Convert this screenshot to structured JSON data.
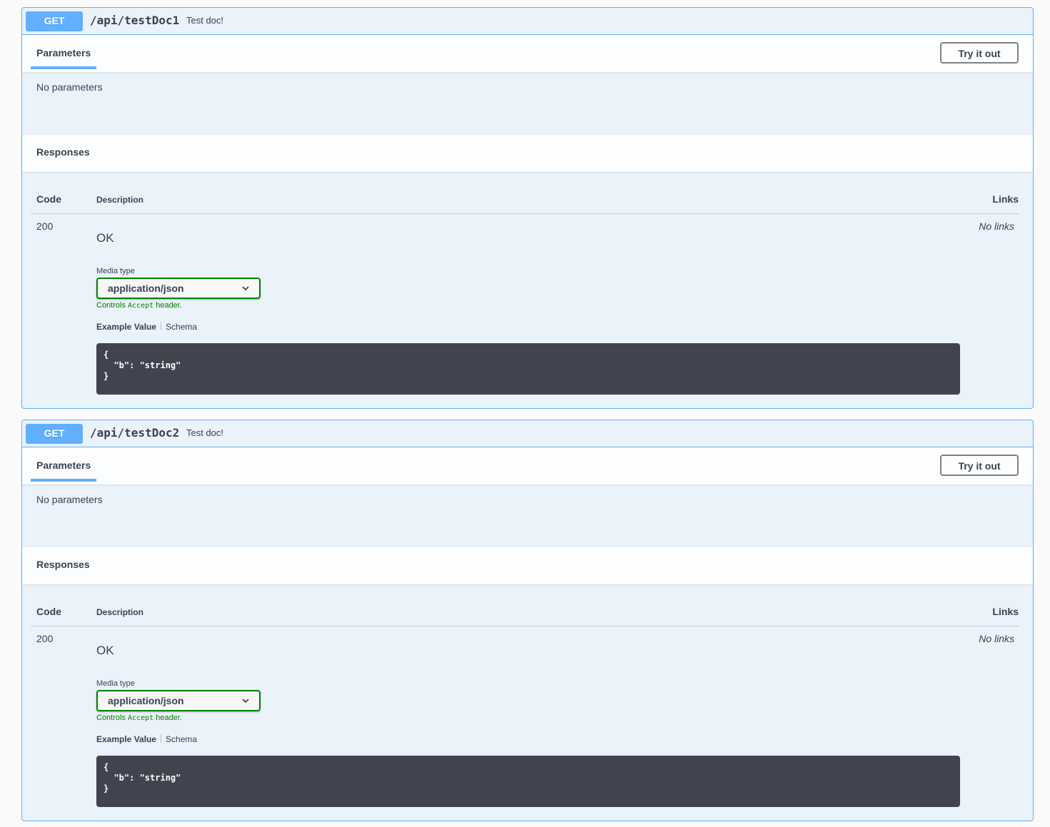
{
  "colors": {
    "get": "#61affe",
    "media_border": "#008000",
    "code_bg": "#41444e"
  },
  "operations": [
    {
      "method": "GET",
      "path": "/api/testDoc1",
      "summary": "Test doc!",
      "parameters_tab": "Parameters",
      "try_it_out": "Try it out",
      "no_parameters": "No parameters",
      "responses_title": "Responses",
      "table_headers": {
        "code": "Code",
        "description": "Description",
        "links": "Links"
      },
      "response": {
        "code": "200",
        "description": "OK",
        "links": "No links",
        "media_type_label": "Media type",
        "media_type": "application/json",
        "controls_pre": "Controls ",
        "controls_code": "Accept",
        "controls_post": " header.",
        "example_value_tab": "Example Value",
        "schema_tab": "Schema",
        "example": "{\n  \"b\": \"string\"\n}"
      }
    },
    {
      "method": "GET",
      "path": "/api/testDoc2",
      "summary": "Test doc!",
      "parameters_tab": "Parameters",
      "try_it_out": "Try it out",
      "no_parameters": "No parameters",
      "responses_title": "Responses",
      "table_headers": {
        "code": "Code",
        "description": "Description",
        "links": "Links"
      },
      "response": {
        "code": "200",
        "description": "OK",
        "links": "No links",
        "media_type_label": "Media type",
        "media_type": "application/json",
        "controls_pre": "Controls ",
        "controls_code": "Accept",
        "controls_post": " header.",
        "example_value_tab": "Example Value",
        "schema_tab": "Schema",
        "example": "{\n  \"b\": \"string\"\n}"
      }
    }
  ]
}
